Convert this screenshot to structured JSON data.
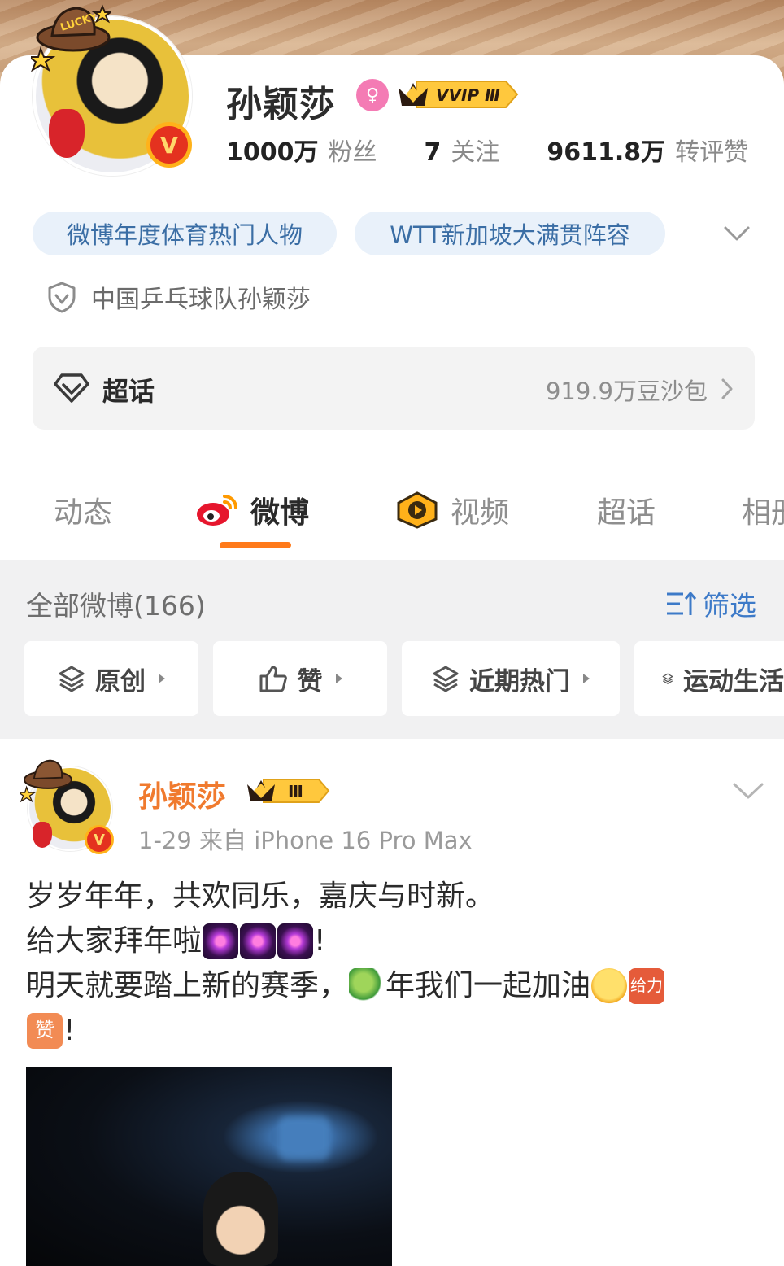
{
  "profile": {
    "username": "孙颖莎",
    "vip_badge_text": "VVIP Ⅲ",
    "hat_text": "LUCKY",
    "verified_symbol": "V",
    "stats": [
      {
        "value": "1000万",
        "label": "粉丝"
      },
      {
        "value": "7",
        "label": "关注"
      },
      {
        "value": "9611.8万",
        "label": "转评赞"
      }
    ],
    "tags": [
      "微博年度体育热门人物",
      "WTT新加坡大满贯阵容"
    ],
    "certification": "中国乒乓球队孙颖莎",
    "supertopic": {
      "label": "超话",
      "count": "919.9万豆沙包"
    }
  },
  "tabs": [
    {
      "label": "动态",
      "icon": null
    },
    {
      "label": "微博",
      "icon": "weibo-logo-icon",
      "active": true
    },
    {
      "label": "视频",
      "icon": "video-play-icon"
    },
    {
      "label": "超话",
      "icon": null
    },
    {
      "label": "相册",
      "icon": null
    }
  ],
  "feed": {
    "count_label": "全部微博(166)",
    "filter_label": "筛选",
    "chips": [
      "原创",
      "赞",
      "近期热门",
      "运动生活"
    ]
  },
  "post": {
    "author": "孙颖莎",
    "vip_text": "Ⅲ",
    "meta": "1-29  来自 iPhone 16 Pro Max",
    "line1": "岁岁年年，共欢同乐，嘉庆与时新。",
    "line2_text": "给大家拜年啦",
    "line2_end": "!",
    "line3_text": "明天就要踏上新的赛季，",
    "line3_mid": "年我们一起加油",
    "go_emoji_text": "给力",
    "zan_emoji_text": "赞",
    "line4_end": "!"
  },
  "colors": {
    "accent_orange": "#ff7a1a",
    "link_blue": "#3d7ac8",
    "tag_bg": "#e9f1fa",
    "tag_text": "#3b6ea5",
    "verified_red": "#e4321f",
    "vip_gold": "#ffb21a"
  }
}
